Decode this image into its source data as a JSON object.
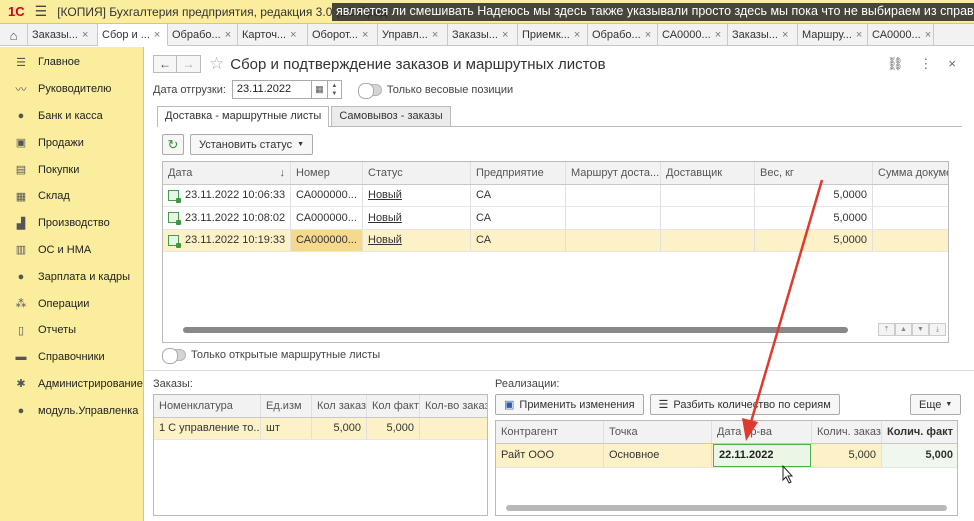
{
  "window": {
    "title": "[КОПИЯ] Бухгалтерия предприятия, редакция 3.0  (1С:Пред",
    "overlay_text": "является ли смешивать Надеюсь мы здесь также указывали просто здесь мы пока что не выбираем из справочни"
  },
  "tabs": [
    {
      "label": "Заказы...",
      "close": "×"
    },
    {
      "label": "Сбор и ...",
      "close": "×",
      "active": true
    },
    {
      "label": "Обрабо...",
      "close": "×"
    },
    {
      "label": "Карточ...",
      "close": "×"
    },
    {
      "label": "Оборот...",
      "close": "×"
    },
    {
      "label": "Управл...",
      "close": "×"
    },
    {
      "label": "Заказы...",
      "close": "×"
    },
    {
      "label": "Приемк...",
      "close": "×"
    },
    {
      "label": "Обрабо...",
      "close": "×"
    },
    {
      "label": "СА0000...",
      "close": "×"
    },
    {
      "label": "Заказы...",
      "close": "×"
    },
    {
      "label": "Маршру...",
      "close": "×"
    },
    {
      "label": "СА0000...",
      "close": "×"
    }
  ],
  "sidebar": {
    "items": [
      {
        "label": "Главное",
        "icon": "menu-icon"
      },
      {
        "label": "Руководителю",
        "icon": "trend-icon"
      },
      {
        "label": "Банк и касса",
        "icon": "bank-icon"
      },
      {
        "label": "Продажи",
        "icon": "cart-icon"
      },
      {
        "label": "Покупки",
        "icon": "purchase-icon"
      },
      {
        "label": "Склад",
        "icon": "warehouse-icon"
      },
      {
        "label": "Производство",
        "icon": "factory-icon"
      },
      {
        "label": "ОС и НМА",
        "icon": "assets-icon"
      },
      {
        "label": "Зарплата и кадры",
        "icon": "person-icon"
      },
      {
        "label": "Операции",
        "icon": "operations-icon"
      },
      {
        "label": "Отчеты",
        "icon": "reports-icon"
      },
      {
        "label": "Справочники",
        "icon": "book-icon"
      },
      {
        "label": "Администрирование",
        "icon": "gear-icon"
      },
      {
        "label": "модуль.Управленка",
        "icon": "module-icon"
      }
    ]
  },
  "page": {
    "title": "Сбор и подтверждение заказов и маршрутных листов"
  },
  "filters": {
    "date_label": "Дата отгрузки:",
    "date_value": "23.11.2022",
    "weight_only_label": "Только весовые позиции",
    "open_routes_label": "Только открытые маршрутные листы"
  },
  "inner_tabs": [
    "Доставка - маршрутные листы",
    "Самовывоз - заказы"
  ],
  "toolbar": {
    "set_status": "Установить статус"
  },
  "routes_table": {
    "columns": [
      "Дата",
      "Номер",
      "Статус",
      "Предприятие",
      "Маршрут доста...",
      "Доставщик",
      "Вес, кг",
      "Сумма докуме"
    ],
    "rows": [
      {
        "date": "23.11.2022 10:06:33",
        "number": "СА000000...",
        "status": "Новый",
        "company": "СА",
        "route": "",
        "courier": "",
        "weight": "5,0000",
        "sum": ""
      },
      {
        "date": "23.11.2022 10:08:02",
        "number": "СА000000...",
        "status": "Новый",
        "company": "СА",
        "route": "",
        "courier": "",
        "weight": "5,0000",
        "sum": ""
      },
      {
        "date": "23.11.2022 10:19:33",
        "number": "СА000000...",
        "status": "Новый",
        "company": "СА",
        "route": "",
        "courier": "",
        "weight": "5,0000",
        "sum": ""
      }
    ]
  },
  "orders": {
    "label": "Заказы:",
    "columns": [
      "Номенклатура",
      "Ед.изм",
      "Кол заказ",
      "Кол факт",
      "Кол-во заказ"
    ],
    "rows": [
      {
        "item": "1 С управление то...",
        "unit": "шт",
        "qty_order": "5,000",
        "qty_fact": "5,000",
        "qty2": ""
      }
    ]
  },
  "sales": {
    "label": "Реализации:",
    "apply_btn": "Применить изменения",
    "split_btn": "Разбить количество по сериям",
    "more_btn": "Еще",
    "columns": [
      "Контрагент",
      "Точка",
      "Дата пр-ва",
      "Колич. заказ",
      "Колич. факт"
    ],
    "rows": [
      {
        "counterparty": "Райт ООО",
        "point": "Основное",
        "prod_date": "22.11.2022",
        "qty_order": "5,000",
        "qty_fact": "5,000"
      }
    ]
  },
  "colors": {
    "accent_yellow": "#fbed9e",
    "selection": "#fdf2c7",
    "arrow": "#e03a2f"
  }
}
